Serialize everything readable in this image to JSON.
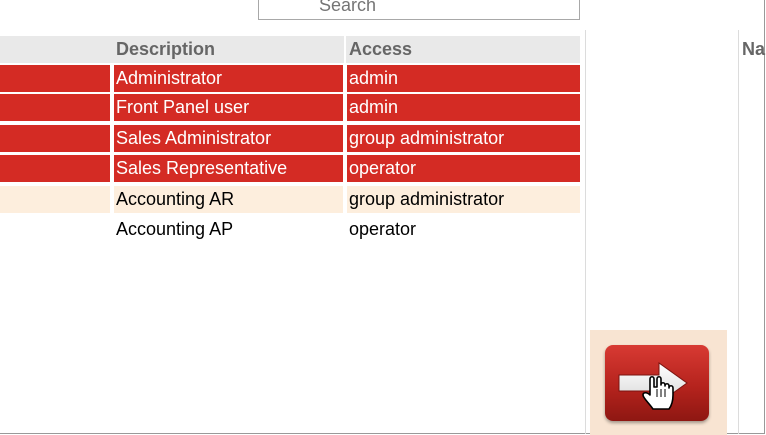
{
  "search": {
    "placeholder": "Search"
  },
  "table": {
    "columns": {
      "description": "Description",
      "access": "Access"
    },
    "rows": [
      {
        "description": "Administrator",
        "access": "admin",
        "state": "selected"
      },
      {
        "description": "Front Panel user",
        "access": "admin",
        "state": "selected"
      },
      {
        "description": "Sales Administrator",
        "access": "group administrator",
        "state": "selected"
      },
      {
        "description": "Sales Representative",
        "access": "operator",
        "state": "selected"
      },
      {
        "description": "Accounting AR",
        "access": "group administrator",
        "state": "highlighted"
      },
      {
        "description": "Accounting AP",
        "access": "operator",
        "state": "normal"
      }
    ]
  },
  "right_panel": {
    "header": "Na"
  },
  "move_button": {
    "icon": "arrow-right-icon",
    "cursor_icon": "hand-pointer-icon"
  },
  "colors": {
    "selected_row": "#d42b24",
    "highlighted_row": "#fdeedd",
    "header_bg": "#e9e9e9",
    "button_bg": "#f8e4d2"
  }
}
